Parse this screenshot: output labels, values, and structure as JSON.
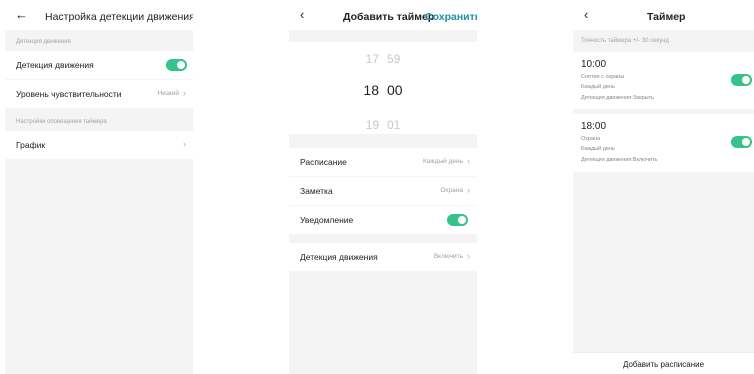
{
  "panel1": {
    "back_icon": "arrow-left-icon",
    "title": "Настройка детекции движения",
    "section1": "Детекция движения",
    "motion_label": "Детекция движения",
    "sensitivity_label": "Уровень чувствительности",
    "sensitivity_value": "Низкий",
    "section2": "Настройки оповещения таймера",
    "schedule_label": "График"
  },
  "panel2": {
    "back_icon": "chevron-left-icon",
    "title": "Добавить таймер",
    "save": "Сохранить",
    "picker": {
      "prev_hour": "17",
      "prev_minute": "59",
      "hour": "18",
      "minute": "00",
      "next_hour": "19",
      "next_minute": "01"
    },
    "schedule_label": "Расписание",
    "schedule_value": "Каждый день",
    "note_label": "Заметка",
    "note_value": "Охрана",
    "notify_label": "Уведомление",
    "motion_label": "Детекция движения",
    "motion_value": "Включить"
  },
  "panel3": {
    "back_icon": "chevron-left-icon",
    "title": "Таймер",
    "accuracy_note": "Точность таймера +/- 30 секунд",
    "timers": [
      {
        "time": "10:00",
        "note": "Снятие с охраны",
        "repeat": "Каждый день",
        "action": "Детекция движения:Закрыть",
        "enabled": true
      },
      {
        "time": "18:00",
        "note": "Охрана",
        "repeat": "Каждый день",
        "action": "Детекция движения:Включить",
        "enabled": true
      }
    ],
    "add_button": "Добавить расписание"
  },
  "colors": {
    "accent_green": "#35c28b",
    "link_teal": "#1f8fa6",
    "background": "#f4f4f4"
  },
  "toggles": {
    "motion_detection": true,
    "notification": true
  }
}
